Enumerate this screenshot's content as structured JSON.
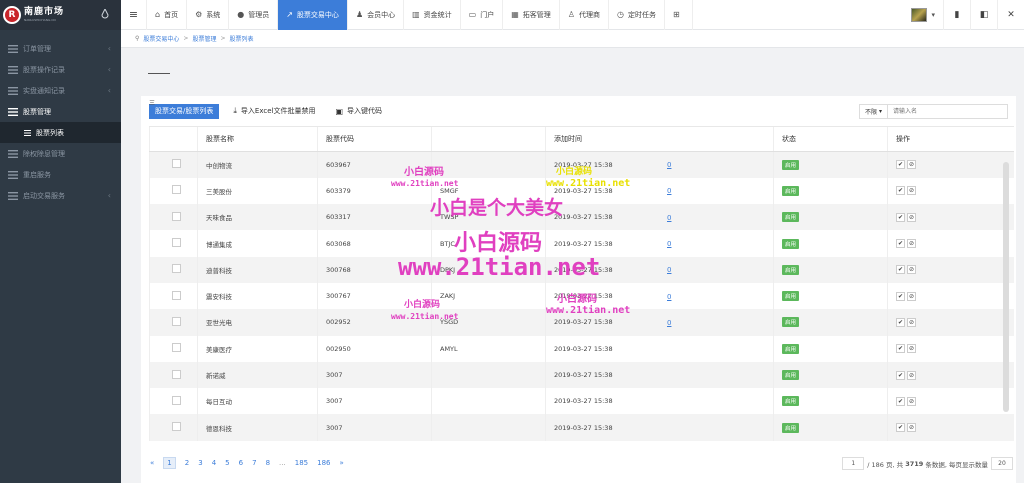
{
  "brand": {
    "name": "南鹿市场",
    "tagline": "NANLUSHICHANG.CN",
    "mark": "R"
  },
  "sidebar": {
    "items": [
      {
        "label": "订单管理",
        "expandable": true
      },
      {
        "label": "股票操作记录",
        "expandable": true
      },
      {
        "label": "实盘通知记录",
        "expandable": true
      },
      {
        "label": "股票管理",
        "expandable": false,
        "open": true
      },
      {
        "label": "股票列表",
        "sub": true
      },
      {
        "label": "除权除息管理",
        "expandable": false
      },
      {
        "label": "重启服务",
        "expandable": false
      },
      {
        "label": "启动交易服务",
        "expandable": true
      }
    ]
  },
  "topnav": {
    "menu_icon": "≡",
    "tabs": [
      {
        "label": "首页",
        "icon": "home-icon",
        "glyph": "⌂"
      },
      {
        "label": "系统",
        "icon": "gear-icon",
        "glyph": "⚙"
      },
      {
        "label": "管理员",
        "icon": "user-icon",
        "glyph": "●"
      },
      {
        "label": "股票交易中心",
        "icon": "chart-icon",
        "glyph": "↗",
        "active": true
      },
      {
        "label": "会员中心",
        "icon": "users-icon",
        "glyph": "♟"
      },
      {
        "label": "资金统计",
        "icon": "bar-chart-icon",
        "glyph": "▥"
      },
      {
        "label": "门户",
        "icon": "window-icon",
        "glyph": "▭"
      },
      {
        "label": "拓客管理",
        "icon": "grid-icon",
        "glyph": "▦"
      },
      {
        "label": "代理商",
        "icon": "person-icon",
        "glyph": "♙"
      },
      {
        "label": "定时任务",
        "icon": "clock-icon",
        "glyph": "◷"
      },
      {
        "label": "",
        "icon": "apps-icon",
        "glyph": "⊞"
      }
    ],
    "right_glyphs": [
      "▾",
      "▮",
      "◧",
      "✕"
    ]
  },
  "breadcrumb": {
    "home_glyph": "⚲",
    "items": [
      "股票交易中心",
      "股票管理",
      "股票列表"
    ]
  },
  "page": {
    "tab_label": "三",
    "dash": "-----"
  },
  "toolbar": {
    "primary_label": "股票交易/股票列表",
    "import_excel_label": "导入Excel文件批量禁用",
    "import_scan_label": "导入键代码",
    "filter_select": "不限",
    "search_placeholder": "请输入名"
  },
  "table": {
    "headers": [
      "",
      "股票名称",
      "股票代码",
      "",
      "添加时间",
      "状态",
      "操作"
    ],
    "rows": [
      {
        "name": "中创物流",
        "code": "603967",
        "pinyin": "",
        "time": "2019-03-27 15:38",
        "zero": "0",
        "status": "启用"
      },
      {
        "name": "三美股份",
        "code": "603379",
        "pinyin": "SMGF",
        "time": "2019-03-27 15:38",
        "zero": "0",
        "status": "启用"
      },
      {
        "name": "天味食品",
        "code": "603317",
        "pinyin": "TWSP",
        "time": "2019-03-27 15:38",
        "zero": "0",
        "status": "启用"
      },
      {
        "name": "博通集成",
        "code": "603068",
        "pinyin": "BTJC",
        "time": "2019-03-27 15:38",
        "zero": "0",
        "status": "启用"
      },
      {
        "name": "迪普科技",
        "code": "300768",
        "pinyin": "DPKJ",
        "time": "2019-03-27 15:38",
        "zero": "0",
        "status": "启用"
      },
      {
        "name": "震安科技",
        "code": "300767",
        "pinyin": "ZAKJ",
        "time": "2019-03-27 15:38",
        "zero": "0",
        "status": "启用"
      },
      {
        "name": "亚世光电",
        "code": "002952",
        "pinyin": "YSGD",
        "time": "2019-03-27 15:38",
        "zero": "0",
        "status": "启用"
      },
      {
        "name": "美康医疗",
        "code": "002950",
        "pinyin": "AMYL",
        "time": "2019-03-27 15:38",
        "zero": "",
        "status": "启用"
      },
      {
        "name": "新诺威",
        "code": "3007",
        "pinyin": "",
        "time": "2019-03-27 15:38",
        "zero": "",
        "status": "启用"
      },
      {
        "name": "每日互动",
        "code": "3007",
        "pinyin": "",
        "time": "2019-03-27 15:38",
        "zero": "",
        "status": "启用"
      },
      {
        "name": "德恩科技",
        "code": "3007",
        "pinyin": "",
        "time": "2019-03-27 15:38",
        "zero": "",
        "status": "启用"
      }
    ],
    "op_glyphs": [
      "✔",
      "⊘"
    ]
  },
  "pagination": {
    "prev": "«",
    "pages": [
      "1",
      "2",
      "3",
      "4",
      "5",
      "6",
      "7",
      "8",
      "...",
      "185",
      "186"
    ],
    "next": "»",
    "current_input": "1",
    "total_pages_text": "/ 186 页, 共",
    "total_records": "3719",
    "records_text": "条数据, 每页显示数量",
    "page_size": "20"
  },
  "watermarks": {
    "t1": "小白源码",
    "t2": "www.21tian.net",
    "t3": "小白是个大美女",
    "t4": "小白源码",
    "t5": "www.21tian.net"
  },
  "colors": {
    "accent": "#3c7dd9",
    "sidebar": "#2f3a45",
    "success": "#5cb85c",
    "brand_red": "#c9262b"
  }
}
